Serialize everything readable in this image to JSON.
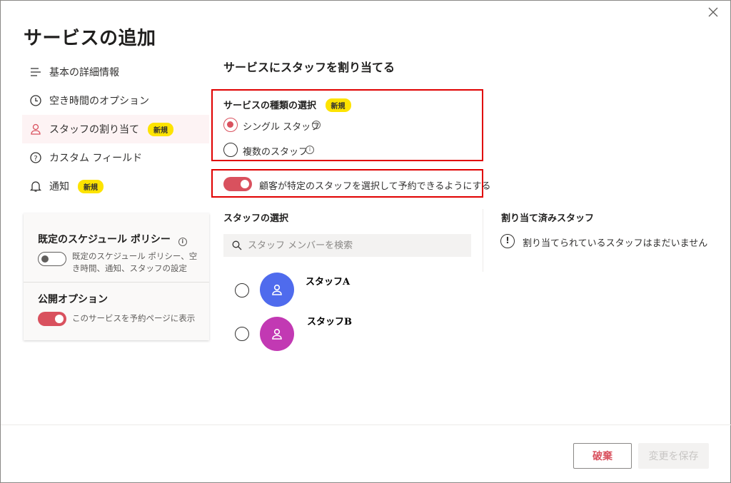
{
  "dialog": {
    "title": "サービスの追加"
  },
  "nav": {
    "items": [
      {
        "label": "基本の詳細情報",
        "icon": "list-icon"
      },
      {
        "label": "空き時間のオプション",
        "icon": "clock-icon"
      },
      {
        "label": "スタッフの割り当て",
        "icon": "person-icon",
        "badge": "新規",
        "active": true
      },
      {
        "label": "カスタム フィールド",
        "icon": "question-icon"
      },
      {
        "label": "通知",
        "icon": "bell-icon",
        "badge": "新規"
      }
    ]
  },
  "policy": {
    "heading": "既定のスケジュール ポリシー",
    "toggle_text": "既定のスケジュール ポリシー、空き時間、通知、スタッフの設定",
    "toggle_on": false,
    "publish_heading": "公開オプション",
    "publish_text": "このサービスを予約ページに表示",
    "publish_on": true
  },
  "main": {
    "heading": "サービスにスタッフを割り当てる",
    "service_type": {
      "heading": "サービスの種類の選択",
      "badge": "新規",
      "options": [
        {
          "label": "シングル スタッフ",
          "selected": true
        },
        {
          "label": "複数のスタッフ",
          "selected": false
        }
      ]
    },
    "customer_toggle": {
      "label": "顧客が特定のスタッフを選択して予約できるようにする",
      "on": true
    },
    "staff_select": {
      "heading": "スタッフの選択",
      "search_placeholder": "スタッフ メンバーを検索",
      "staff": [
        {
          "name": "スタッフA",
          "color": "#4f6bed"
        },
        {
          "name": "スタッフB",
          "color": "#c239b3"
        }
      ]
    },
    "assigned": {
      "heading": "割り当て済みスタッフ",
      "empty_text": "割り当てられているスタッフはまだいません"
    }
  },
  "footer": {
    "discard_label": "破棄",
    "save_label": "変更を保存"
  },
  "colors": {
    "accent": "#d9515e",
    "badge": "#fde300",
    "highlight_box": "#e00000"
  }
}
